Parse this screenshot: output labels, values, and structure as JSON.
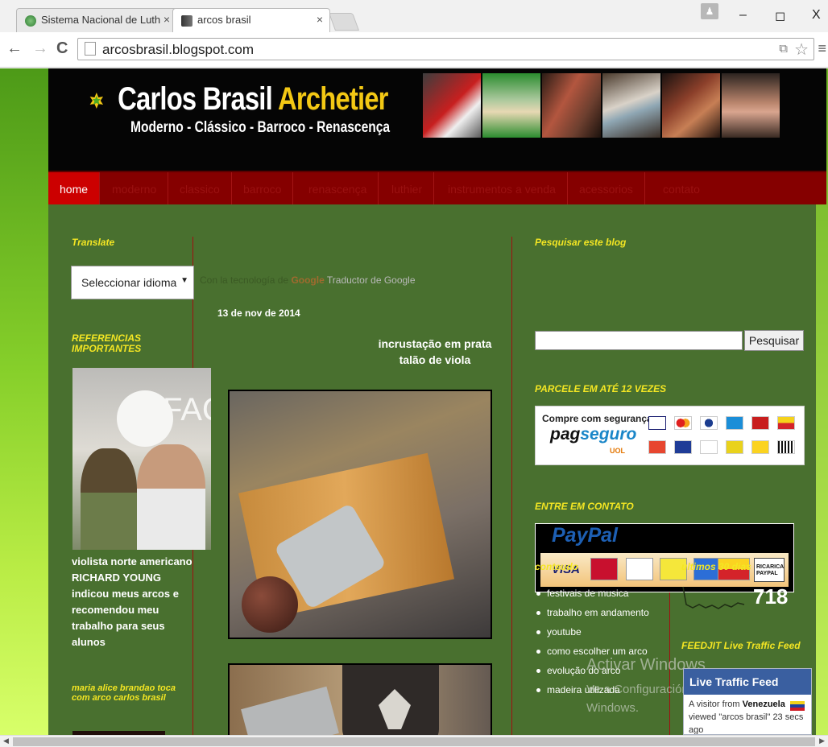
{
  "browser": {
    "tabs": [
      {
        "title": "Sistema Nacional de Luth",
        "close": "×"
      },
      {
        "title": "arcos brasil",
        "close": "×"
      }
    ],
    "url": "arcosbrasil.blogspot.com",
    "window_controls": {
      "minimize": "–",
      "maximize": "◻",
      "close": "X"
    }
  },
  "header": {
    "title_white": "Carlos Brasil",
    "title_accent": "Archetier",
    "subtitle": "Moderno - Clássico - Barroco - Renascença"
  },
  "nav": {
    "items": [
      "home",
      "moderno",
      "classico",
      "barroco",
      "renascença",
      "luthier",
      "instrumentos a venda",
      "acessorios",
      "contato"
    ]
  },
  "left_sidebar": {
    "translate_title": "Translate",
    "select_value": "Seleccionar idioma",
    "powered_prefix": "Con la tecnología de",
    "powered_google": "Google",
    "powered_suffix": "Traductor de Google",
    "references_title": "REFERENCIAS IMPORTANTES",
    "fac_text": "FAC",
    "ref_caption": "violista norte americano RICHARD YOUNG indicou meus arcos e recomendou meu trabalho para seus alunos",
    "video_title": "maria alice brandao toca com arco carlos brasil"
  },
  "post": {
    "date": "13 de nov de 2014",
    "title": "incrustação em prata talão de viola"
  },
  "right_sidebar": {
    "search_title": "Pesquisar este blog",
    "search_button": "Pesquisar",
    "parcele_title": "PARCELE EM ATÉ 12 VEZES",
    "pagseguro_compre": "Compre com segurança",
    "pagseguro_logo_a": "pag",
    "pagseguro_logo_b": "seguro",
    "pagseguro_uol": "UOL",
    "contato_title": "ENTRE EM CONTATO",
    "paypal_logo": "PayPal",
    "paypal_visa": "VISA",
    "paypal_ricarica": "RICARICA PAYPAL",
    "conteudo_title": "conteudo",
    "conteudo_items": [
      "festivais de musica",
      "trabalho em andamento",
      "youtube",
      "como escolher um arco",
      "evolução do arco",
      "madeira utilizada"
    ],
    "stats_title": "ultimos 30 dias",
    "stats_value": "718",
    "feedjit_title": "FEEDJIT Live Traffic Feed",
    "feed_head": "Live Traffic Feed",
    "feed_from": "A visitor from",
    "feed_country": "Venezuela",
    "feed_viewed": "viewed",
    "feed_page": "\"arcos brasil\"",
    "feed_time": "23 secs ago"
  },
  "watermark": {
    "line1": "Activar Windows",
    "line2": "Ve a Configuración para activar",
    "line3": "Windows."
  },
  "colors": {
    "header_bg": "#050505",
    "title_accent": "#f3c814",
    "navbar_bg": "#850000",
    "nav_active": "#cc0000",
    "content_bg": "#49702f",
    "widget_title": "#f4e623"
  }
}
